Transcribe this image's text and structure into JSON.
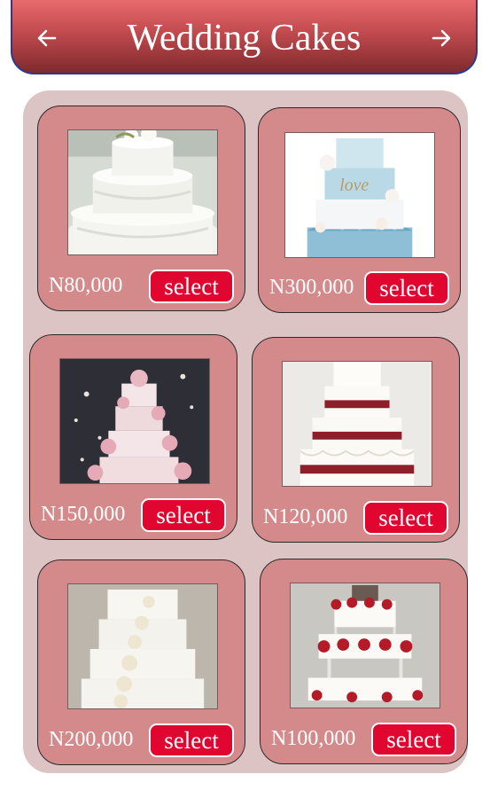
{
  "header": {
    "title": "Wedding Cakes",
    "back_icon": "arrow-left-icon",
    "forward_icon": "arrow-right-icon"
  },
  "colors": {
    "header_top": "#e86a6d",
    "header_bottom": "#7e2a2d",
    "panel": "#dcc3c4",
    "card": "#d48a8b",
    "select_button": "#e0062f"
  },
  "cakes": [
    {
      "price": "N80,000",
      "select_label": "select",
      "image": "white lace tiered cake with flowers"
    },
    {
      "price": "N300,000",
      "select_label": "select",
      "image": "blue and white love cake with roses"
    },
    {
      "price": "N150,000",
      "select_label": "select",
      "image": "pink blossom tiered cake"
    },
    {
      "price": "N120,000",
      "select_label": "select",
      "image": "white cake with burgundy ribbons"
    },
    {
      "price": "N200,000",
      "select_label": "select",
      "image": "white cascading rose cake"
    },
    {
      "price": "N100,000",
      "select_label": "select",
      "image": "white cake with red roses on pillars"
    }
  ]
}
